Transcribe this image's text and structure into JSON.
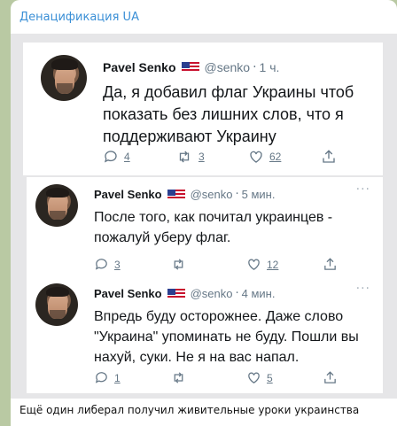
{
  "channel": {
    "name": "Денацификация UA"
  },
  "tweets": [
    {
      "author": "Pavel Senko",
      "handle": "@senko",
      "time": "1 ч.",
      "text": "Да, я добавил флаг Украины чтоб\nпоказать без лишних слов, что я\nподдерживают Украину",
      "replies": "4",
      "retweets": "3",
      "likes": "62"
    },
    {
      "author": "Pavel Senko",
      "handle": "@senko",
      "time": "5 мин.",
      "text": "После того, как почитал украинцев -\nпожалуй уберу флаг.",
      "replies": "3",
      "retweets": "",
      "likes": "12"
    },
    {
      "author": "Pavel Senko",
      "handle": "@senko",
      "time": "4 мин.",
      "text": "Впредь буду осторожнее. Даже слово\n\"Украина\" упоминать не буду. Пошли вы\nнахуй, суки. Не я на вас напал.",
      "replies": "1",
      "retweets": "",
      "likes": "5"
    }
  ],
  "caption": "Ещё один либерал получил живительные уроки украинства",
  "icons": {
    "reply": "reply-icon",
    "retweet": "retweet-icon",
    "like": "heart-icon",
    "share": "share-icon",
    "more": "more-icon"
  },
  "colors": {
    "channel": "#3a8fd6",
    "background": "#b9c9a3",
    "muted": "#657786"
  }
}
